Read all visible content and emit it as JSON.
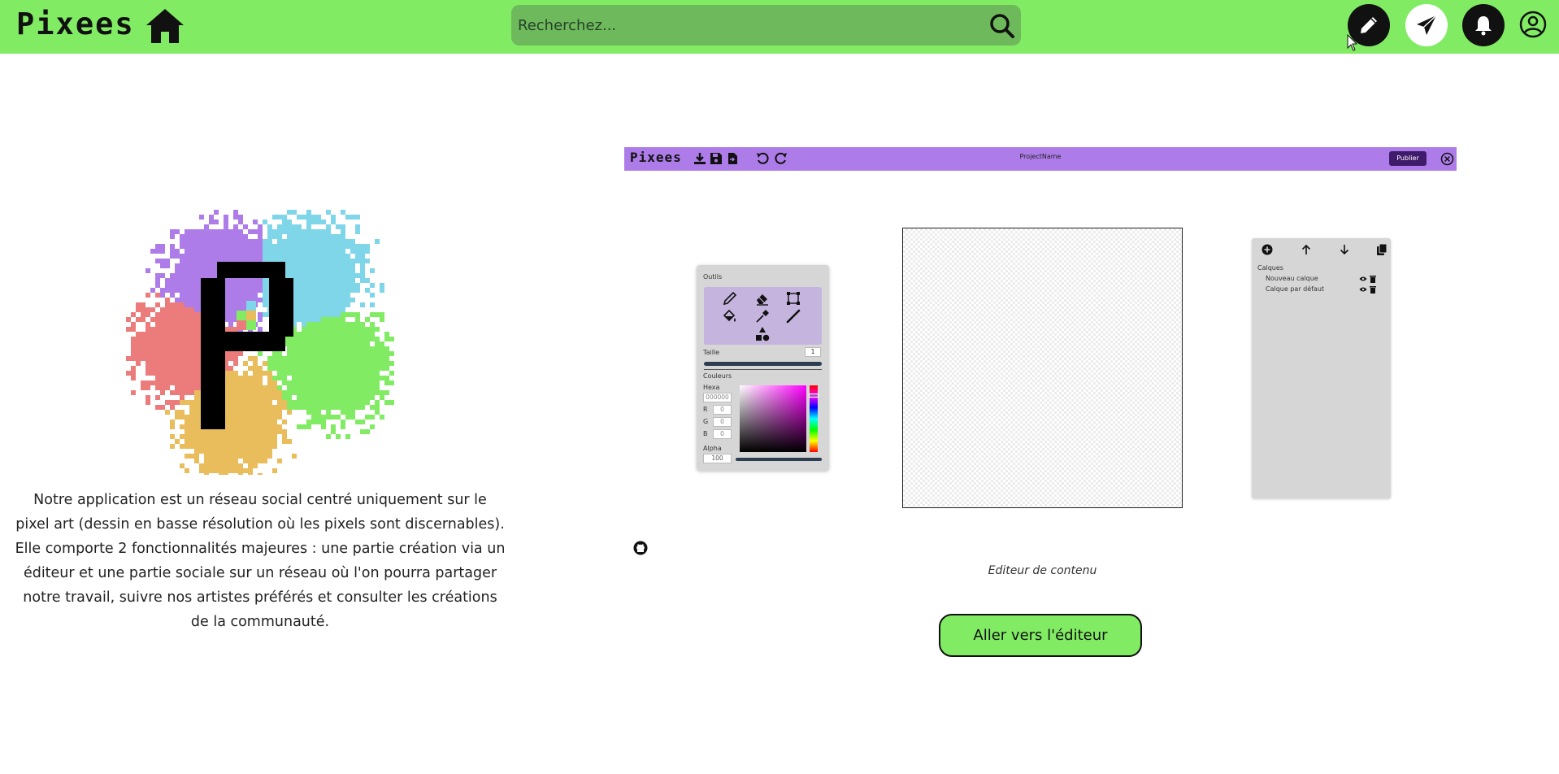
{
  "header": {
    "brand": "Pixees",
    "search_placeholder": "Recherchez...",
    "icons": [
      "home-icon",
      "search-icon",
      "pencil-icon",
      "send-icon",
      "bell-icon",
      "user-circle-icon"
    ],
    "bar_color": "#81ec63"
  },
  "intro": {
    "logo_letter": "P",
    "text": "Notre application est un réseau social centré uniquement sur le pixel art (dessin en basse résolution où les pixels sont discernables). Elle comporte 2 fonctionnalités majeures : une partie création via un éditeur et une partie sociale sur un réseau où l'on pourra partager notre travail, suivre nos artistes préférés et consulter les créations de la communauté."
  },
  "editor": {
    "brand": "Pixees",
    "project_name": "ProjectName",
    "publish_label": "Publier",
    "bar_color": "#ad7ce8",
    "tools": {
      "title": "Outils",
      "items": [
        "pencil-icon",
        "eraser-icon",
        "select-icon",
        "fill-icon",
        "eyedropper-icon",
        "line-icon",
        "shapes-icon"
      ],
      "size_label": "Taille",
      "size_value": "1",
      "colors_label": "Couleurs",
      "hexa_label": "Hexa",
      "hexa_value": "000000",
      "r_label": "R",
      "r_value": "0",
      "g_label": "G",
      "g_value": "0",
      "b_label": "B",
      "b_value": "0",
      "alpha_label": "Alpha",
      "alpha_value": "100"
    },
    "layers": {
      "title": "Calques",
      "items": [
        {
          "name": "Nouveau calque"
        },
        {
          "name": "Calque par défaut"
        }
      ]
    },
    "caption": "Editeur de contenu"
  },
  "cta_label": "Aller vers l'éditeur"
}
